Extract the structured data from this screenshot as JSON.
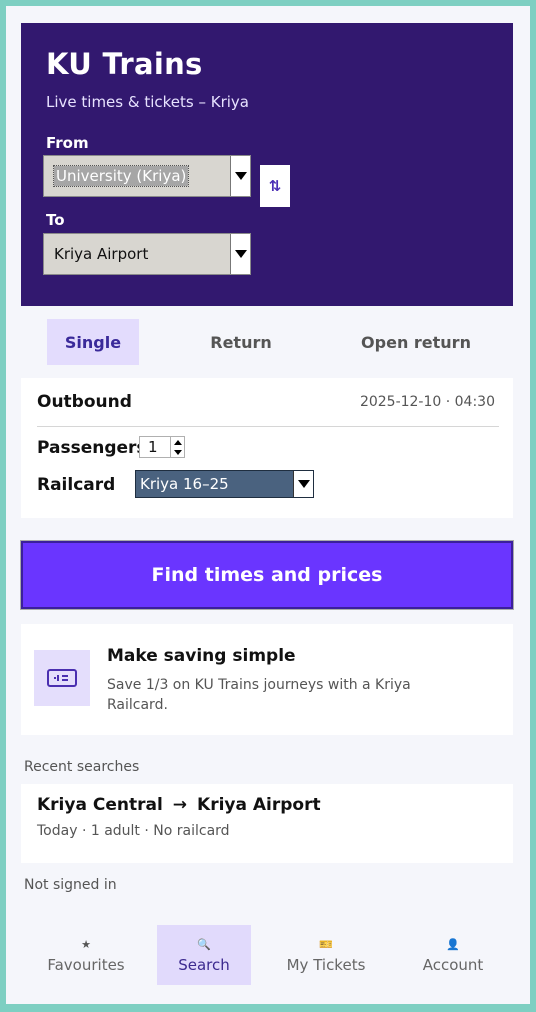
{
  "header": {
    "title": "KU Trains",
    "subtitle": "Live times & tickets – Kriya",
    "from_label": "From",
    "from_value": "University (Kriya)",
    "to_label": "To",
    "to_value": "Kriya Airport",
    "swap_icon": "swap-vertical-icon",
    "swap_glyph": "⇅"
  },
  "tabs": [
    "Single",
    "Return",
    "Open return"
  ],
  "active_tab": "Single",
  "journey": {
    "outbound_label": "Outbound",
    "outbound_datetime": "2025-12-10 · 04:30",
    "passengers_label": "Passengers",
    "passengers_value": "1",
    "railcard_label": "Railcard",
    "railcard_value": "Kriya 16–25"
  },
  "cta_label": "Find times and prices",
  "promo": {
    "icon": "ticket-icon",
    "title": "Make saving simple",
    "body": "Save 1/3 on KU Trains journeys with a Kriya Railcard."
  },
  "recent": {
    "heading": "Recent searches",
    "items": [
      {
        "from": "Kriya Central",
        "arrow": "→",
        "to": "Kriya Airport",
        "meta": "Today · 1 adult · No railcard"
      }
    ]
  },
  "status": "Not signed in",
  "nav": {
    "items": [
      {
        "label": "Favourites",
        "icon": "star-icon",
        "glyph": "★"
      },
      {
        "label": "Search",
        "icon": "search-icon",
        "glyph": "🔍"
      },
      {
        "label": "My Tickets",
        "icon": "ticket-icon",
        "glyph": "🎫"
      },
      {
        "label": "Account",
        "icon": "person-icon",
        "glyph": "👤"
      }
    ],
    "active": "Search"
  },
  "colors": {
    "header_bg": "#32186f",
    "accent": "#6a35ff",
    "tab_active_bg": "#e3dcfd",
    "frame_border": "#7ecfc2"
  }
}
